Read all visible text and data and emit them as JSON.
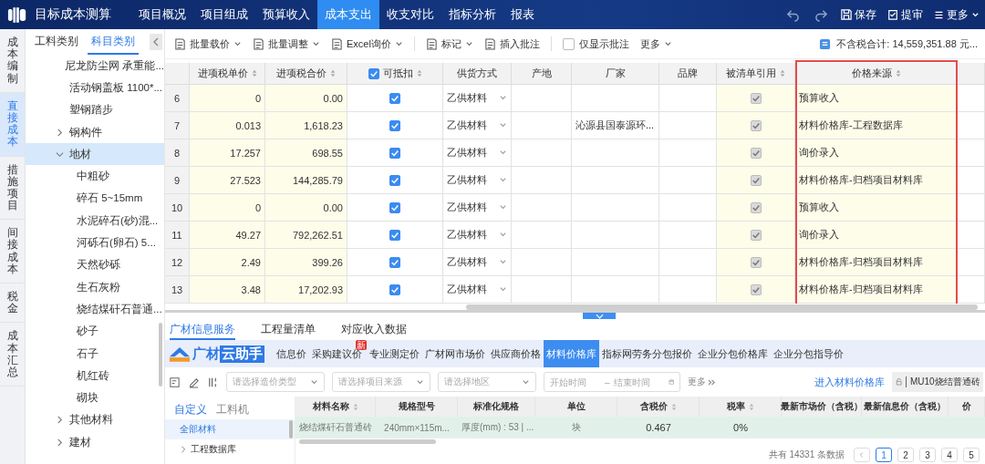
{
  "app": {
    "title": "目标成本测算"
  },
  "nav": [
    {
      "label": "项目概况",
      "selected": false
    },
    {
      "label": "项目组成",
      "selected": false
    },
    {
      "label": "预算收入",
      "selected": false
    },
    {
      "label": "成本支出",
      "selected": true
    },
    {
      "label": "收支对比",
      "selected": false
    },
    {
      "label": "指标分析",
      "selected": false
    },
    {
      "label": "报表",
      "selected": false
    }
  ],
  "actions": [
    {
      "label": "保存",
      "kind": "save"
    },
    {
      "label": "提审",
      "kind": "submit"
    },
    {
      "label": "更多",
      "kind": "more"
    }
  ],
  "side_nav": [
    {
      "label": "成本编制",
      "selected": false
    },
    {
      "label": "直接成本",
      "selected": true
    },
    {
      "label": "措施项目",
      "selected": false
    },
    {
      "label": "间接成本",
      "selected": false
    },
    {
      "label": "税金",
      "selected": false
    },
    {
      "label": "成本汇总",
      "selected": false
    }
  ],
  "tree": {
    "tabs": [
      {
        "label": "工料类别",
        "selected": false
      },
      {
        "label": "科目类别",
        "selected": true
      }
    ],
    "items": [
      {
        "label": "尼龙防尘网 承重能...",
        "kind": "leaf",
        "selected": false
      },
      {
        "label": "活动钢盖板 1100*...",
        "kind": "leaf",
        "selected": false
      },
      {
        "label": "塑钢踏步",
        "kind": "leaf",
        "selected": false
      },
      {
        "label": "钢构件",
        "kind": "group",
        "expanded": false,
        "selected": false
      },
      {
        "label": "地材",
        "kind": "group",
        "expanded": true,
        "selected": true,
        "children": [
          {
            "label": "中粗砂",
            "selected": false
          },
          {
            "label": "碎石 5~15mm",
            "selected": false
          },
          {
            "label": "水泥碎石(砂)混...",
            "selected": false
          },
          {
            "label": "河砾石(卵石) 5...",
            "selected": false
          },
          {
            "label": "天然砂砾",
            "selected": false
          },
          {
            "label": "生石灰粉",
            "selected": false
          },
          {
            "label": "烧结煤矸石普通...",
            "selected": false
          },
          {
            "label": "砂子",
            "selected": false
          },
          {
            "label": "石子",
            "selected": false
          },
          {
            "label": "机红砖",
            "selected": false
          },
          {
            "label": "砌块",
            "selected": false
          }
        ]
      },
      {
        "label": "其他材料",
        "kind": "group",
        "expanded": false,
        "selected": false
      },
      {
        "label": "建材",
        "kind": "group",
        "expanded": false,
        "selected": false
      }
    ]
  },
  "toolbar": {
    "groups": [
      [
        {
          "label": "批量载价",
          "kind": "menu"
        },
        {
          "label": "批量调整",
          "kind": "menu"
        },
        {
          "label": "Excel询价",
          "kind": "menu"
        }
      ],
      [
        {
          "label": "标记",
          "kind": "menu"
        },
        {
          "label": "插入批注",
          "kind": "button"
        }
      ],
      [
        {
          "label": "仅显示批注",
          "kind": "checkbox",
          "checked": false
        },
        {
          "label": "更多",
          "kind": "more"
        }
      ]
    ],
    "total": "不含税合计: 14,559,351.88 元..."
  },
  "table": {
    "columns": [
      {
        "label": "进项税单价",
        "kind": "number",
        "sortable": true,
        "tinted": true
      },
      {
        "label": "进项税合价",
        "kind": "number",
        "sortable": true,
        "tinted": true
      },
      {
        "label": "可抵扣",
        "kind": "checkbox",
        "sortable": true,
        "tinted": false,
        "header_checked": true
      },
      {
        "label": "供货方式",
        "kind": "select",
        "sortable": false,
        "tinted": false
      },
      {
        "label": "产地",
        "kind": "text",
        "sortable": false,
        "tinted": false
      },
      {
        "label": "厂家",
        "kind": "text",
        "sortable": false,
        "tinted": false
      },
      {
        "label": "品牌",
        "kind": "text",
        "sortable": false,
        "tinted": false
      },
      {
        "label": "被清单引用",
        "kind": "locked_checkbox",
        "sortable": true,
        "tinted": true
      },
      {
        "label": "价格来源",
        "kind": "text",
        "sortable": true,
        "tinted": true,
        "highlighted": true
      }
    ],
    "rows": [
      {
        "number": "6",
        "unit_tax": "0",
        "total_tax": "0.00",
        "deductible": true,
        "supply": "乙供材料",
        "referenced": true,
        "source": "预算收入"
      },
      {
        "number": "7",
        "unit_tax": "0.013",
        "total_tax": "1,618.23",
        "deductible": true,
        "supply": "乙供材料",
        "maker": "沁源县国泰源环...",
        "referenced": true,
        "source": "材料价格库-工程数据库"
      },
      {
        "number": "8",
        "unit_tax": "17.257",
        "total_tax": "698.55",
        "deductible": true,
        "supply": "乙供材料",
        "referenced": true,
        "source": "询价录入"
      },
      {
        "number": "9",
        "unit_tax": "27.523",
        "total_tax": "144,285.79",
        "deductible": true,
        "supply": "乙供材料",
        "referenced": true,
        "source": "材料价格库-归档项目材料库"
      },
      {
        "number": "10",
        "unit_tax": "0",
        "total_tax": "0.00",
        "deductible": true,
        "supply": "乙供材料",
        "referenced": true,
        "source": "预算收入"
      },
      {
        "number": "11",
        "unit_tax": "49.27",
        "total_tax": "792,262.51",
        "deductible": true,
        "supply": "乙供材料",
        "referenced": true,
        "source": "询价录入"
      },
      {
        "number": "12",
        "unit_tax": "2.49",
        "total_tax": "399.26",
        "deductible": true,
        "supply": "乙供材料",
        "referenced": true,
        "source": "材料价格库-归档项目材料库"
      },
      {
        "number": "13",
        "unit_tax": "3.48",
        "total_tax": "17,202.93",
        "deductible": true,
        "supply": "乙供材料",
        "referenced": true,
        "source": "材料价格库-归档项目材料库"
      }
    ]
  },
  "bottom": {
    "tabs": [
      {
        "label": "广材信息服务",
        "selected": true
      },
      {
        "label": "工程量清单",
        "selected": false
      },
      {
        "label": "对应收入数据",
        "selected": false
      }
    ],
    "brand": {
      "text": "广材",
      "tag": "云助手"
    },
    "services": [
      {
        "label": "信息价",
        "selected": false
      },
      {
        "label": "采购建议价",
        "selected": false,
        "badge": "新"
      },
      {
        "label": "专业测定价",
        "selected": false
      },
      {
        "label": "广材网市场价",
        "selected": false
      },
      {
        "label": "供应商价格",
        "selected": false
      },
      {
        "label": "材料价格库",
        "selected": true
      },
      {
        "label": "指标网劳务分包报价",
        "selected": false
      },
      {
        "label": "企业分包价格库",
        "selected": false
      },
      {
        "label": "企业分包指导价",
        "selected": false
      }
    ],
    "filters": {
      "selects": [
        {
          "placeholder": "请选择造价类型"
        },
        {
          "placeholder": "请选择项目来源"
        },
        {
          "placeholder": "请选择地区"
        }
      ],
      "start": {
        "placeholder": "开始时间"
      },
      "separator": "–",
      "end": {
        "placeholder": "结束时间"
      },
      "more": "更多",
      "link": "进入材料价格库",
      "search": {
        "value": "MU10烧结普通砖"
      }
    },
    "panel_tabs": [
      {
        "label": "自定义",
        "selected": true
      },
      {
        "label": "工料机",
        "selected": false
      }
    ],
    "categories": [
      {
        "label": "全部材料",
        "kind": "leaf",
        "selected": true
      },
      {
        "label": "工程数据库",
        "kind": "group",
        "expanded": false,
        "selected": false
      }
    ],
    "columns": [
      {
        "label": "材料名称",
        "sortable": true
      },
      {
        "label": "规格型号",
        "sortable": false
      },
      {
        "label": "标准化规格",
        "sortable": false
      },
      {
        "label": "单位",
        "sortable": false
      },
      {
        "label": "含税价",
        "sortable": true
      },
      {
        "label": "税率",
        "sortable": true
      },
      {
        "label": "最新市场价（含税）",
        "sortable": false
      },
      {
        "label": "最新信息价（含税）",
        "sortable": false
      },
      {
        "label": "价",
        "sortable": false
      }
    ],
    "rows": [
      {
        "selected": true,
        "name": "烧结煤矸石普通砖",
        "spec": "240mm×115m...",
        "std_spec": "厚度(mm) : 53 | ...",
        "unit": "块",
        "price": "0.467",
        "tax_rate": "0%"
      }
    ],
    "pagination": {
      "summary": "共有 14331 条数据",
      "pages": [
        {
          "label": "1",
          "selected": true
        },
        {
          "label": "2",
          "selected": false
        },
        {
          "label": "3",
          "selected": false
        },
        {
          "label": "4",
          "selected": false
        },
        {
          "label": "5",
          "selected": false
        }
      ]
    }
  }
}
